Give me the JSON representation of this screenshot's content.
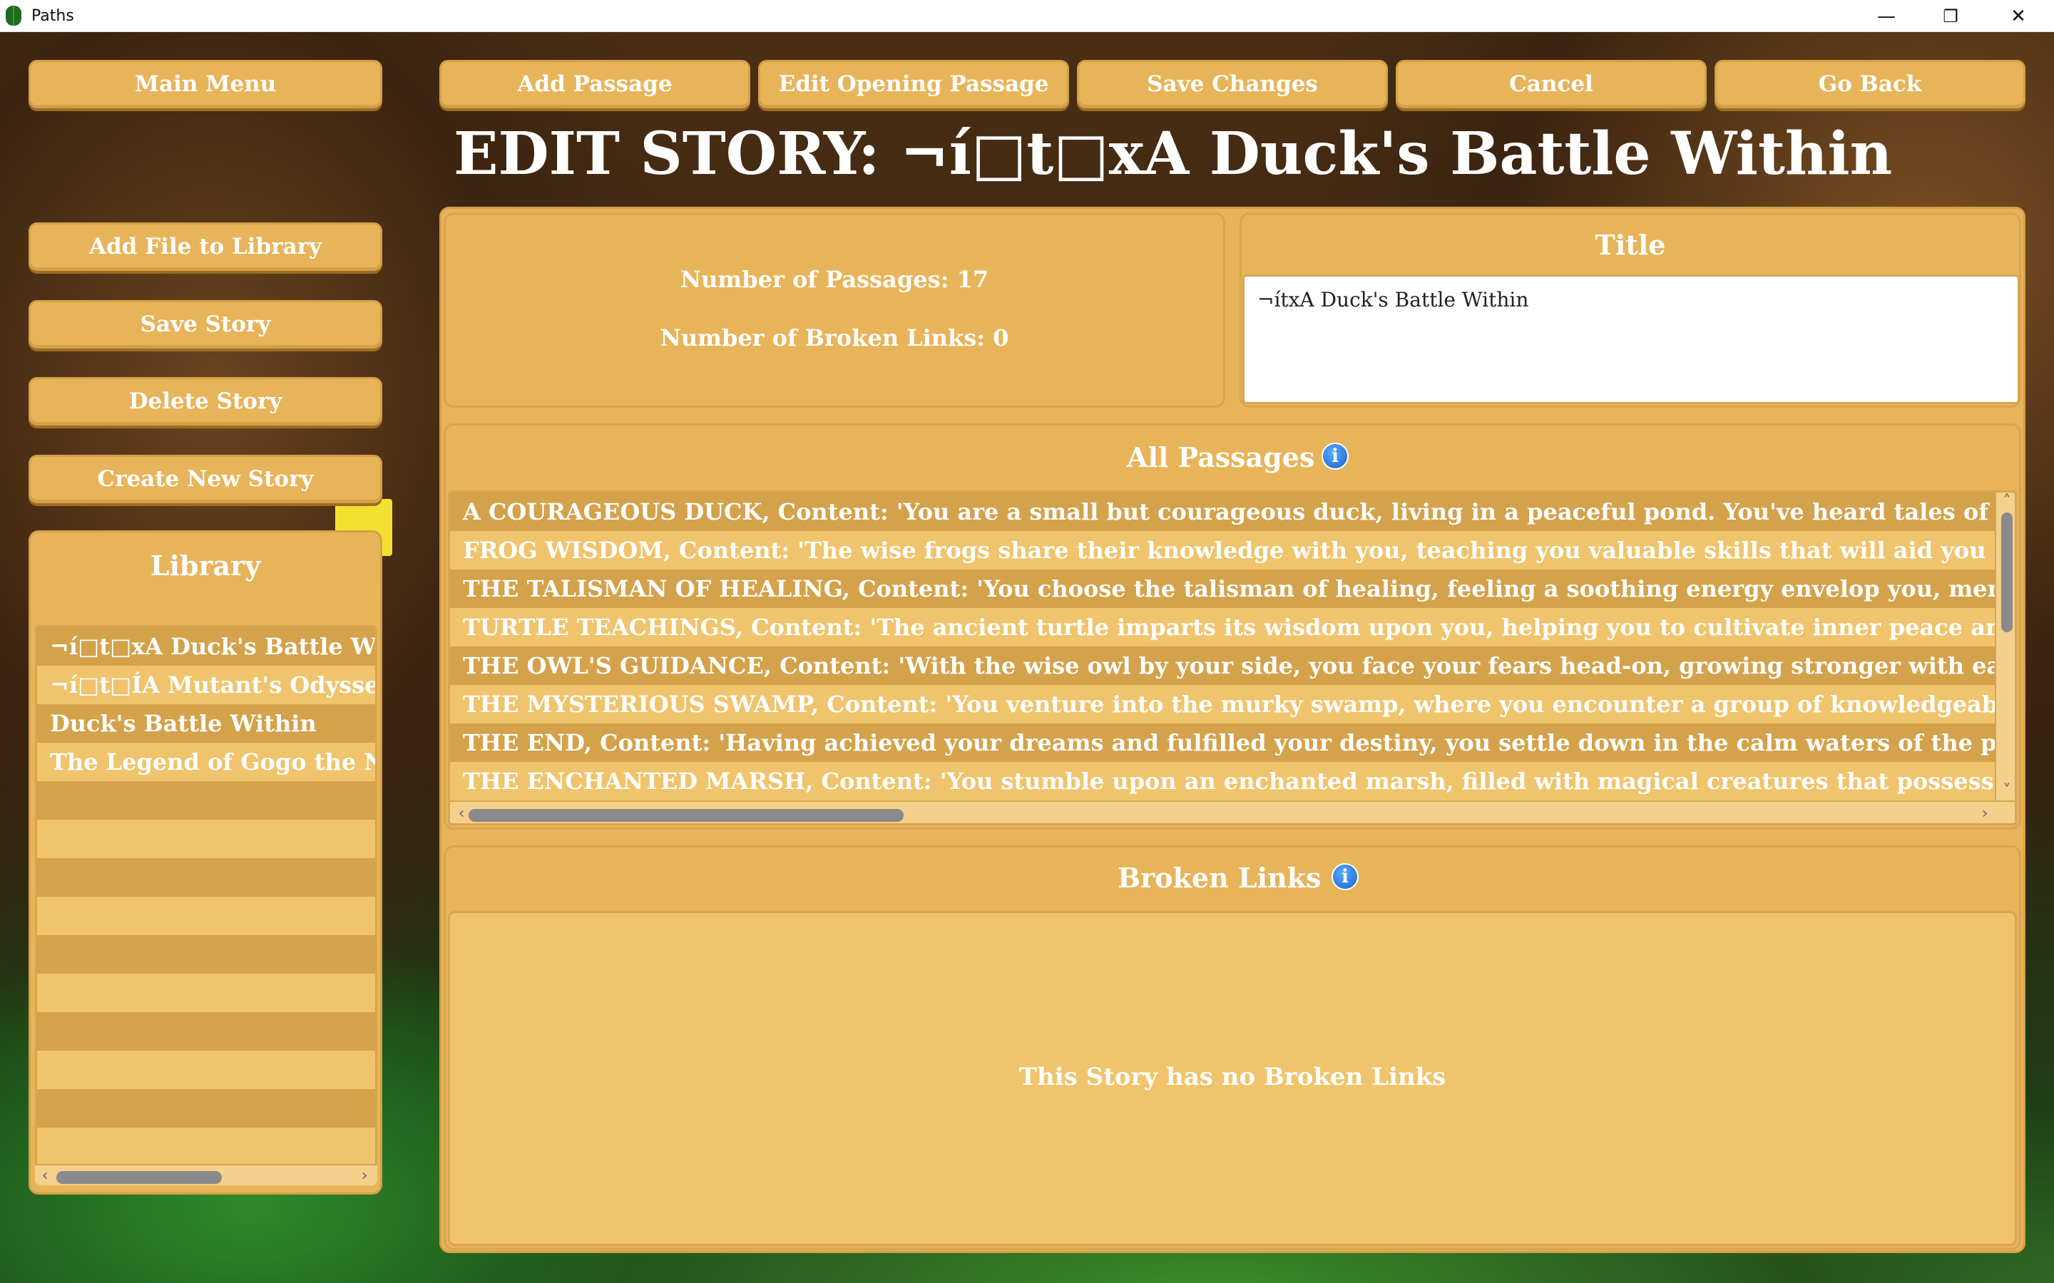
{
  "window": {
    "title": "Paths",
    "minimize_glyph": "—",
    "maximize_glyph": "❐",
    "close_glyph": "✕"
  },
  "sidebar": {
    "main_menu": "Main Menu",
    "add_file": "Add File to Library",
    "save_story": "Save Story",
    "delete_story": "Delete Story",
    "create_story": "Create New Story",
    "library_heading": "Library",
    "library_items": [
      "¬í□t□xA Duck's Battle Within",
      "¬í□t□ÍA Mutant's Odyssey",
      "Duck's Battle Within",
      "The Legend of Gogo the Ninja"
    ],
    "scroll_left": "‹",
    "scroll_right": "›"
  },
  "toolbar": {
    "add_passage": "Add Passage",
    "edit_opening": "Edit Opening Passage",
    "save_changes": "Save Changes",
    "cancel": "Cancel",
    "go_back": "Go Back"
  },
  "page": {
    "heading": "EDIT STORY: ¬í□t□xA Duck's Battle Within"
  },
  "stats": {
    "passages": "Number of Passages: 17",
    "broken_links": "Number of Broken Links: 0"
  },
  "title_panel": {
    "heading": "Title",
    "value": "¬ítxA Duck's Battle Within"
  },
  "passages": {
    "heading": "All Passages",
    "info_glyph": "i",
    "items": [
      "A COURAGEOUS DUCK, Content: 'You are a small but courageous duck, living in a peaceful pond. You've heard tales of legendary c",
      "FROG WISDOM, Content: 'The wise frogs share their knowledge with you, teaching you valuable skills that will aid you in your journ",
      "THE TALISMAN OF HEALING, Content: 'You choose the talisman of healing, feeling a soothing energy envelop you, mending your e",
      "TURTLE TEACHINGS, Content: 'The ancient turtle imparts its wisdom upon you, helping you to cultivate inner peace and balance. T",
      "THE OWL'S GUIDANCE, Content: 'With the wise owl by your side, you face your fears head-on, growing stronger with each challeng",
      "THE MYSTERIOUS SWAMP, Content: 'You venture into the murky swamp, where you encounter a group of knowledgeable frogs. Th",
      "THE END, Content: 'Having achieved your dreams and fulfilled your destiny, you settle down in the calm waters of the pond, content",
      "THE ENCHANTED MARSH, Content: 'You stumble upon an enchanted marsh, filled with magical creatures that possess extraordina"
    ],
    "scroll_up": "˄",
    "scroll_down": "˅",
    "scroll_left": "‹",
    "scroll_right": "›"
  },
  "broken_links": {
    "heading": "Broken Links",
    "info_glyph": "i",
    "empty_message": "This Story has no Broken Links"
  }
}
